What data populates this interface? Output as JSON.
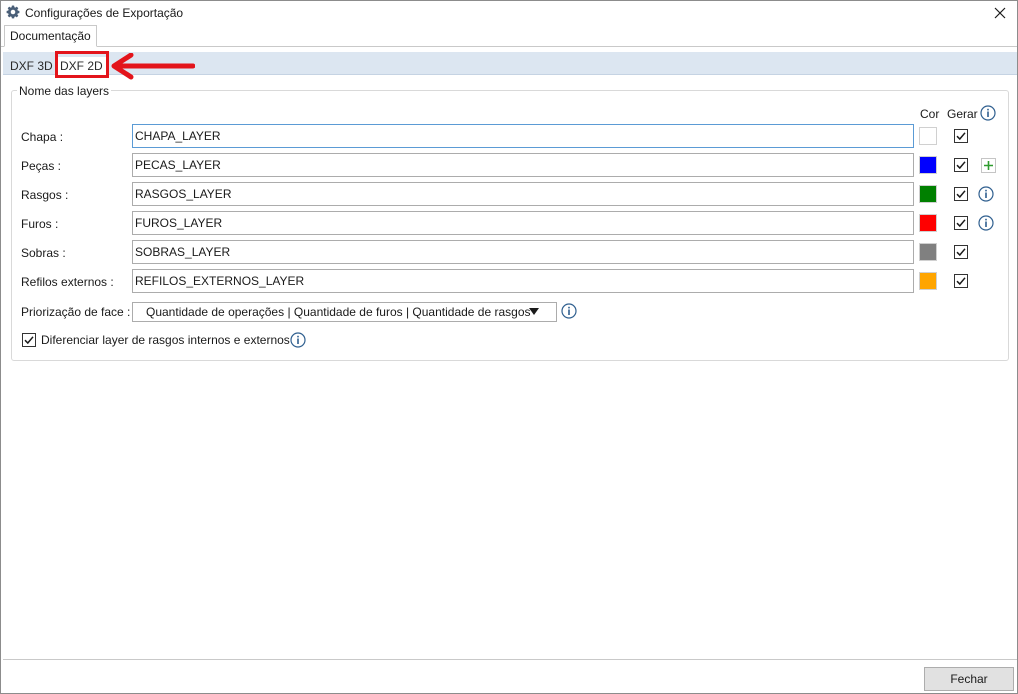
{
  "window": {
    "title": "Configurações de Exportação",
    "close_glyph": "✕"
  },
  "outer_tabs": [
    {
      "label": "Documentação",
      "selected": true
    }
  ],
  "inner_tabs": [
    {
      "label": "DXF 3D",
      "selected": false
    },
    {
      "label": "DXF 2D",
      "selected": true
    }
  ],
  "group": {
    "title": "Nome das layers",
    "col_cor": "Cor",
    "col_gerar": "Gerar"
  },
  "layers": [
    {
      "label": "Chapa :",
      "value": "CHAPA_LAYER",
      "color": "#ffffff",
      "gerar": true
    },
    {
      "label": "Peças :",
      "value": "PECAS_LAYER",
      "color": "#0000ff",
      "gerar": true
    },
    {
      "label": "Rasgos :",
      "value": "RASGOS_LAYER",
      "color": "#008000",
      "gerar": true
    },
    {
      "label": "Furos :",
      "value": "FUROS_LAYER",
      "color": "#ff0000",
      "gerar": true
    },
    {
      "label": "Sobras :",
      "value": "SOBRAS_LAYER",
      "color": "#808080",
      "gerar": true
    },
    {
      "label": "Refilos externos :",
      "value": "REFILOS_EXTERNOS_LAYER",
      "color": "#ffa500",
      "gerar": true
    }
  ],
  "face_priority": {
    "label": "Priorização de face :",
    "value": "Quantidade de operações | Quantidade de furos | Quantidade de rasgos"
  },
  "differentiate": {
    "label": "Diferenciar layer de rasgos internos e externos",
    "checked": true
  },
  "footer": {
    "close_label": "Fechar"
  },
  "icons": {
    "title": "gear-icon",
    "info": "info-icon",
    "plus": "plus-icon",
    "annotation": "red-arrow"
  },
  "colors": {
    "inner_tab_bar": "#dce6f1",
    "highlight": "#e3141b",
    "plus": "#2e9b2e",
    "info": "#2f5f8f"
  }
}
